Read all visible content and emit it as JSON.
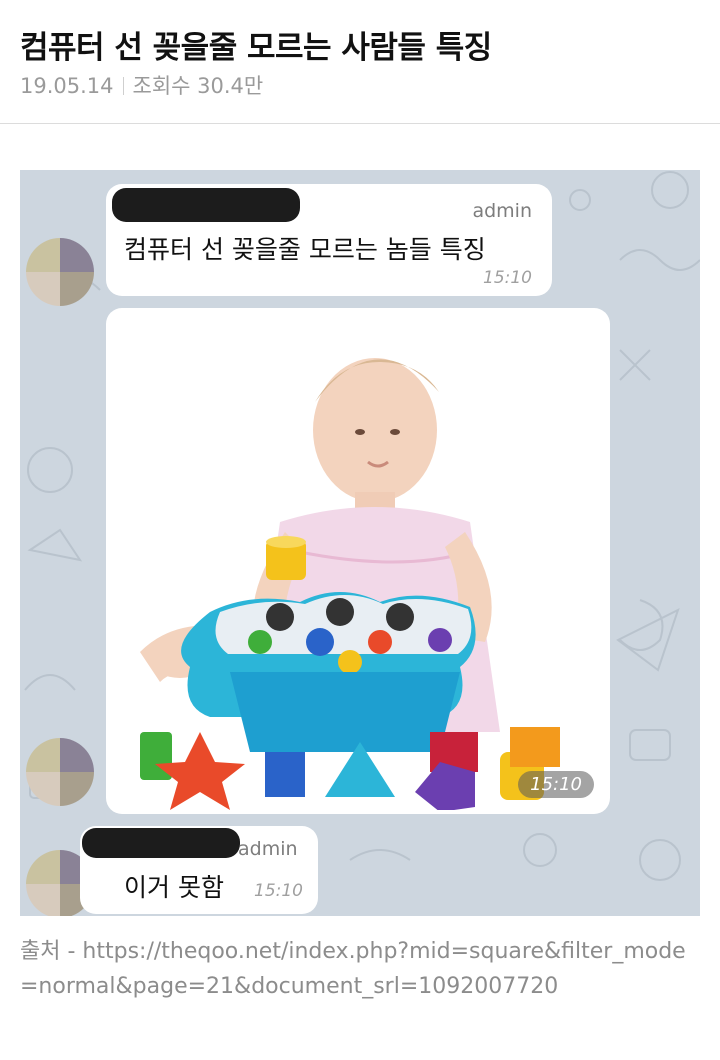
{
  "post": {
    "title": "컴퓨터 선 꽂을줄 모르는 사람들 특징",
    "date": "19.05.14",
    "views": "조회수 30.4만"
  },
  "chat": {
    "first_message": {
      "sender": "admin",
      "text": "컴퓨터 선 꽂을줄 모르는 놈들 특징",
      "time": "15:10"
    },
    "photo_message": {
      "time": "15:10",
      "shape_colors": [
        "#f4c21b",
        "#e94a2a",
        "#2a63c9",
        "#3fae3a",
        "#6b3fb0",
        "#2cb5d8"
      ]
    },
    "last_message": {
      "sender": "admin",
      "text": "이거 못함",
      "time": "15:10"
    }
  },
  "source": {
    "text": "출처 - https://theqoo.net/index.php?mid=square&filter_mode=normal&page=21&document_srl=1092007720"
  },
  "colors": {
    "chat_background": "#cdd6df",
    "bubble": "#ffffff",
    "redaction": "#1c1c1c"
  }
}
